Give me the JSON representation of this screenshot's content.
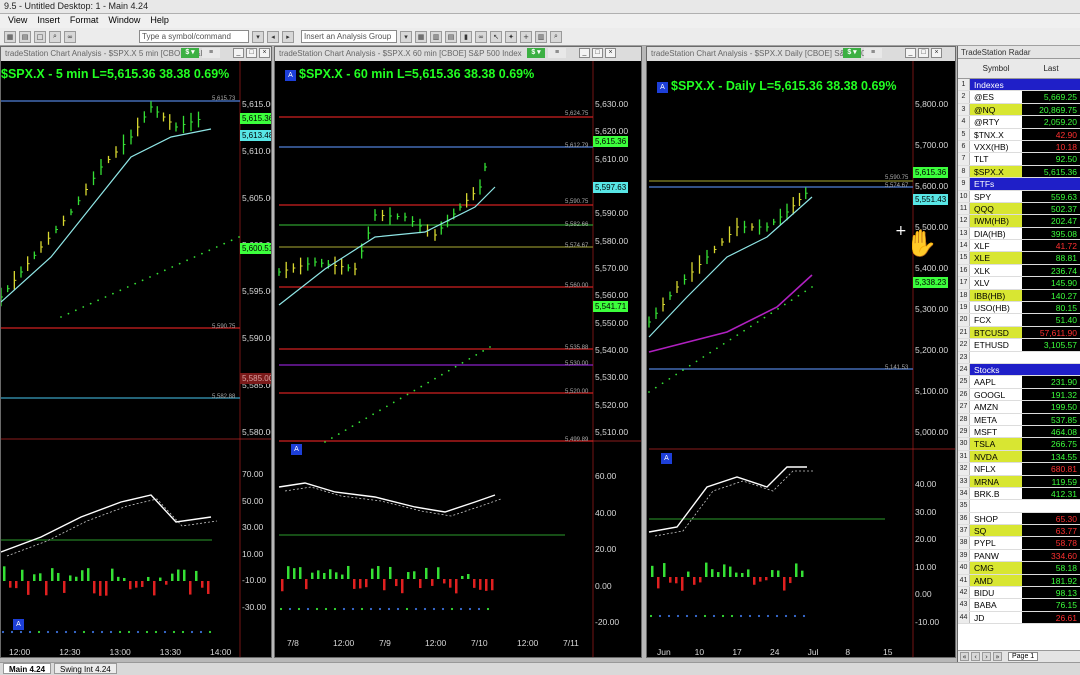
{
  "app": {
    "title": "9.5 - Untitled Desktop: 1 - Main 4.24",
    "menu": [
      "View",
      "Insert",
      "Format",
      "Window",
      "Help"
    ],
    "symbol_placeholder": "Type a symbol/command",
    "analysis_placeholder": "Insert an Analysis Group"
  },
  "charts": [
    {
      "header": "tradeStation Chart Analysis - $SPX.X 5 min [CBOE] S&P...",
      "title": "$SPX.X - 5 min  L=5,615.36  38.38  0.69%",
      "price_axis": [
        "5,615.00",
        "5,610.00",
        "5,605.00",
        "5,600.00",
        "5,595.00",
        "5,590.00",
        "5,585.00",
        "5,580.00"
      ],
      "tags": [
        {
          "text": "5,615.36",
          "color": "#3cff3c"
        },
        {
          "text": "5,613.48",
          "color": "#58e6e6"
        },
        {
          "text": "5,600.51",
          "color": "#3cff3c"
        },
        {
          "text": "5,585.00",
          "color": "#7a1a1a"
        }
      ],
      "levels": [
        "5,615.73",
        "5,590.75",
        "5,582.88"
      ],
      "ind_axis": [
        "70.00",
        "50.00",
        "30.00",
        "10.00",
        "-10.00",
        "-30.00"
      ],
      "time_axis": [
        "12:00",
        "12:30",
        "13:00",
        "13:30",
        "14:00"
      ]
    },
    {
      "header": "tradeStation Chart Analysis - $SPX.X 60 min [CBOE] S&P 500 Index",
      "title": "$SPX.X - 60 min  L=5,615.36  38.38  0.69%",
      "price_axis": [
        "5,630.00",
        "5,620.00",
        "5,610.00",
        "5,600.00",
        "5,590.00",
        "5,580.00",
        "5,570.00",
        "5,560.00",
        "5,550.00",
        "5,540.00",
        "5,530.00",
        "5,520.00",
        "5,510.00"
      ],
      "tags": [
        {
          "text": "5,615.36",
          "color": "#3cff3c"
        },
        {
          "text": "5,597.63",
          "color": "#58e6e6"
        },
        {
          "text": "5,541.71",
          "color": "#3cff3c"
        }
      ],
      "levels": [
        "5,624.75",
        "5,612.79",
        "5,590.75",
        "5,582.66",
        "5,574.67",
        "5,560.00",
        "5,535.88",
        "5,530.00",
        "5,520.00",
        "5,499.89"
      ],
      "ind_axis": [
        "60.00",
        "40.00",
        "20.00",
        "0.00",
        "-20.00"
      ],
      "time_axis": [
        "7/8",
        "12:00",
        "7/9",
        "12:00",
        "7/10",
        "12:00",
        "7/11"
      ]
    },
    {
      "header": "tradeStation Chart Analysis - $SPX.X Daily [CBOE] S&P 500...",
      "title": "$SPX.X - Daily  L=5,615.36  38.38  0.69%",
      "price_axis": [
        "5,800.00",
        "5,700.00",
        "5,600.00",
        "5,500.00",
        "5,400.00",
        "5,300.00",
        "5,200.00",
        "5,100.00",
        "5,000.00"
      ],
      "tags": [
        {
          "text": "5,615.36",
          "color": "#3cff3c"
        },
        {
          "text": "5,551.43",
          "color": "#58e6e6"
        },
        {
          "text": "5,338.23",
          "color": "#3cff3c"
        }
      ],
      "levels": [
        "5,590.75",
        "5,574.67",
        "5,141.53"
      ],
      "ind_axis": [
        "40.00",
        "30.00",
        "20.00",
        "10.00",
        "0.00",
        "-10.00"
      ],
      "time_axis": [
        "Jun",
        "10",
        "17",
        "24",
        "Jul",
        "8",
        "15"
      ]
    }
  ],
  "radar": {
    "title": "TradeStation Radar",
    "col_symbol": "Symbol",
    "col_last": "Last",
    "rows": [
      {
        "n": "1",
        "sym": "Indexes",
        "cat": true
      },
      {
        "n": "2",
        "sym": "@ES",
        "last": "5,669.25",
        "up": true
      },
      {
        "n": "3",
        "sym": "@NQ",
        "last": "20,869.75",
        "up": true,
        "hl": true
      },
      {
        "n": "4",
        "sym": "@RTY",
        "last": "2,059.20",
        "up": true
      },
      {
        "n": "5",
        "sym": "$TNX.X",
        "last": "42.90",
        "up": false
      },
      {
        "n": "6",
        "sym": "VXX(HB)",
        "last": "10.18",
        "up": false
      },
      {
        "n": "7",
        "sym": "TLT",
        "last": "92.50",
        "up": true
      },
      {
        "n": "8",
        "sym": "$SPX.X",
        "last": "5,615.36",
        "up": true,
        "hl": true
      },
      {
        "n": "9",
        "sym": "ETFs",
        "cat": true
      },
      {
        "n": "10",
        "sym": "SPY",
        "last": "559.63",
        "up": true
      },
      {
        "n": "11",
        "sym": "QQQ",
        "last": "502.37",
        "up": true,
        "hl": true
      },
      {
        "n": "12",
        "sym": "IWM(HB)",
        "last": "202.47",
        "up": true,
        "hl": true
      },
      {
        "n": "13",
        "sym": "DIA(HB)",
        "last": "395.08",
        "up": true
      },
      {
        "n": "14",
        "sym": "XLF",
        "last": "41.72",
        "up": false
      },
      {
        "n": "15",
        "sym": "XLE",
        "last": "88.81",
        "up": true,
        "hl": true
      },
      {
        "n": "16",
        "sym": "XLK",
        "last": "236.74",
        "up": true
      },
      {
        "n": "17",
        "sym": "XLV",
        "last": "145.90",
        "up": true
      },
      {
        "n": "18",
        "sym": "IBB(HB)",
        "last": "140.27",
        "up": true,
        "hl": true
      },
      {
        "n": "19",
        "sym": "USO(HB)",
        "last": "80.15",
        "up": true
      },
      {
        "n": "20",
        "sym": "FCX",
        "last": "51.40",
        "up": true
      },
      {
        "n": "21",
        "sym": "BTCUSD",
        "last": "57,611.90",
        "up": false,
        "hl": true
      },
      {
        "n": "22",
        "sym": "ETHUSD",
        "last": "3,105.57",
        "up": true
      },
      {
        "n": "23",
        "sym": "",
        "last": ""
      },
      {
        "n": "24",
        "sym": "Stocks",
        "cat": true
      },
      {
        "n": "25",
        "sym": "AAPL",
        "last": "231.90",
        "up": true
      },
      {
        "n": "26",
        "sym": "GOOGL",
        "last": "191.32",
        "up": true
      },
      {
        "n": "27",
        "sym": "AMZN",
        "last": "199.50",
        "up": true
      },
      {
        "n": "28",
        "sym": "META",
        "last": "537.85",
        "up": true
      },
      {
        "n": "29",
        "sym": "MSFT",
        "last": "464.08",
        "up": true
      },
      {
        "n": "30",
        "sym": "TSLA",
        "last": "266.75",
        "up": true,
        "hl": true
      },
      {
        "n": "31",
        "sym": "NVDA",
        "last": "134.55",
        "up": true,
        "hl": true
      },
      {
        "n": "32",
        "sym": "NFLX",
        "last": "680.81",
        "up": false
      },
      {
        "n": "33",
        "sym": "MRNA",
        "last": "119.59",
        "up": true,
        "hl": true
      },
      {
        "n": "34",
        "sym": "BRK.B",
        "last": "412.31",
        "up": true
      },
      {
        "n": "35",
        "sym": "",
        "last": ""
      },
      {
        "n": "36",
        "sym": "SHOP",
        "last": "65.30",
        "up": false
      },
      {
        "n": "37",
        "sym": "SQ",
        "last": "63.77",
        "up": false,
        "hl": true
      },
      {
        "n": "38",
        "sym": "PYPL",
        "last": "58.78",
        "up": false
      },
      {
        "n": "39",
        "sym": "PANW",
        "last": "334.60",
        "up": false
      },
      {
        "n": "40",
        "sym": "CMG",
        "last": "58.18",
        "up": true,
        "hl": true
      },
      {
        "n": "41",
        "sym": "AMD",
        "last": "181.92",
        "up": true,
        "hl": true
      },
      {
        "n": "42",
        "sym": "BIDU",
        "last": "98.13",
        "up": true
      },
      {
        "n": "43",
        "sym": "BABA",
        "last": "76.15",
        "up": true
      },
      {
        "n": "44",
        "sym": "JD",
        "last": "26.61",
        "up": false
      }
    ],
    "page_tab": "Page 1"
  },
  "tabs": [
    "Main 4.24",
    "Swing Int 4.24"
  ],
  "colors": {
    "green": "#3cff3c",
    "red": "#ff3030",
    "highlight": "#d8e632",
    "category": "#1f1fc8"
  }
}
